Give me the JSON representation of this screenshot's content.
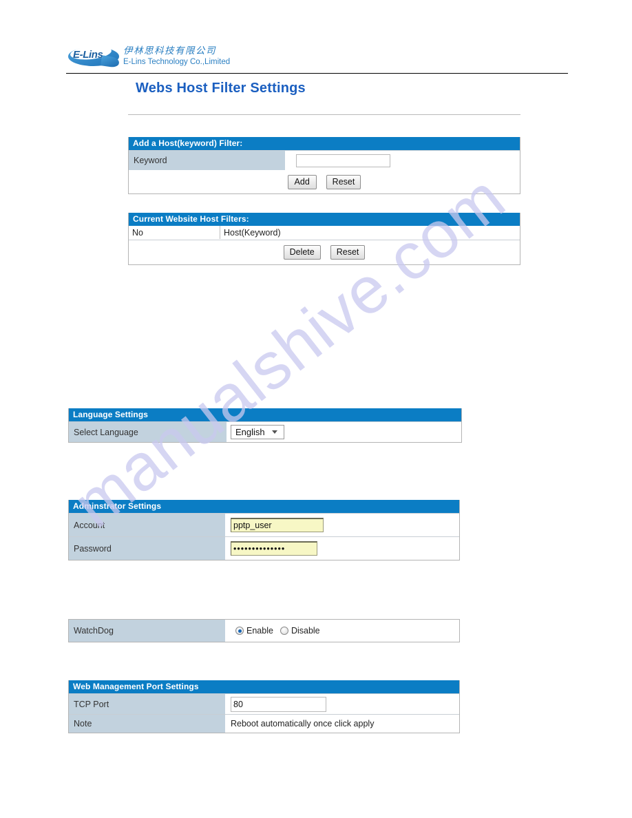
{
  "brand": {
    "logo_word": "E-Lins",
    "company_cn": "伊林思科技有限公司",
    "company_en": "E-Lins Technology Co.,Limited"
  },
  "watermark": {
    "text": "manualshive.com"
  },
  "page": {
    "title": "Webs Host Filter Settings"
  },
  "add_filter": {
    "header": "Add a Host(keyword) Filter:",
    "keyword_label": "Keyword",
    "keyword_value": "",
    "keyword_placeholder": "",
    "add_label": "Add",
    "reset_label": "Reset"
  },
  "current_filters": {
    "header": "Current Website Host Filters:",
    "columns": [
      "No",
      "Host(Keyword)"
    ],
    "rows": [],
    "delete_label": "Delete",
    "reset_label": "Reset"
  },
  "language": {
    "header": "Language Settings",
    "label": "Select Language",
    "selected": "English",
    "options": [
      "English"
    ]
  },
  "administrator": {
    "header": "Adminstrator Settings",
    "account_label": "Account",
    "account_value": "pptp_user",
    "password_label": "Password",
    "password_value": "••••••••••••••"
  },
  "watchdog": {
    "label": "WatchDog",
    "enable_label": "Enable",
    "disable_label": "Disable",
    "selected": "Enable"
  },
  "web_port": {
    "header": "Web Management Port Settings",
    "tcp_port_label": "TCP Port",
    "tcp_port_value": "80",
    "note_label": "Note",
    "note_value": "Reboot automatically once click apply"
  },
  "colors": {
    "header_blue": "#0b7dc4",
    "title_blue": "#1b5fc0",
    "label_cell": "#c2d2de",
    "input_yellow": "#f7f7c5",
    "watermark": "#c9c9ef"
  }
}
